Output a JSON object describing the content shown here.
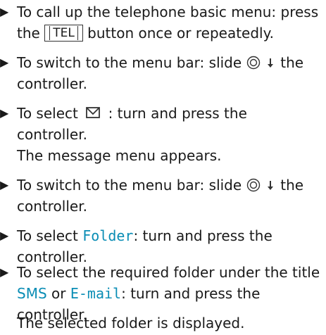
{
  "steps": [
    {
      "part1": "To call up the telephone basic menu: press",
      "part2a": "the ",
      "key": "TEL",
      "part2b": " button once or repeatedly."
    },
    {
      "part1a": "To switch to the menu bar: slide ",
      "part1b": " the",
      "part2": "controller.",
      "icons": [
        "controller-icon",
        "arrow-down-icon"
      ]
    },
    {
      "part1a": "To select ",
      "part1b": " : turn and press the",
      "part2": "controller.",
      "result": "The message menu appears.",
      "icon": "envelope-icon"
    },
    {
      "part1a": "To switch to the menu bar: slide ",
      "part1b": " the",
      "part2": "controller.",
      "icons": [
        "controller-icon",
        "arrow-down-icon"
      ]
    },
    {
      "part1a": "To select ",
      "folder": "Folder",
      "part1b": ": turn and press the",
      "part2": "controller."
    },
    {
      "part1": "To select the required folder under the title",
      "sms": "SMS",
      "or": " or ",
      "email": "E-mail",
      "part2b": ": turn and press the",
      "part3": "controller.",
      "result": "The selected folder is displayed."
    }
  ],
  "bullet_glyph": "▶",
  "highlight_color": "#0a8db5"
}
